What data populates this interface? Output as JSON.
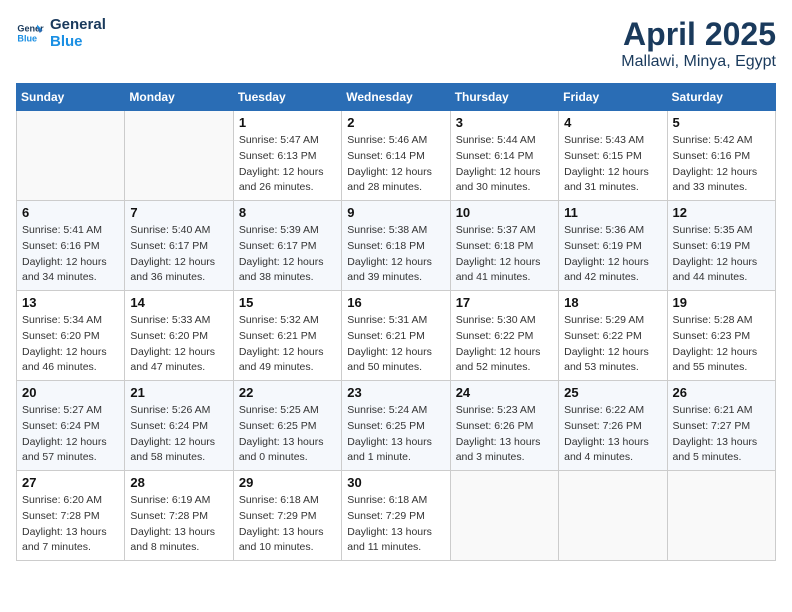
{
  "logo": {
    "line1": "General",
    "line2": "Blue"
  },
  "title": "April 2025",
  "subtitle": "Mallawi, Minya, Egypt",
  "days_of_week": [
    "Sunday",
    "Monday",
    "Tuesday",
    "Wednesday",
    "Thursday",
    "Friday",
    "Saturday"
  ],
  "weeks": [
    [
      {
        "day": "",
        "info": ""
      },
      {
        "day": "",
        "info": ""
      },
      {
        "day": "1",
        "info": "Sunrise: 5:47 AM\nSunset: 6:13 PM\nDaylight: 12 hours and 26 minutes."
      },
      {
        "day": "2",
        "info": "Sunrise: 5:46 AM\nSunset: 6:14 PM\nDaylight: 12 hours and 28 minutes."
      },
      {
        "day": "3",
        "info": "Sunrise: 5:44 AM\nSunset: 6:14 PM\nDaylight: 12 hours and 30 minutes."
      },
      {
        "day": "4",
        "info": "Sunrise: 5:43 AM\nSunset: 6:15 PM\nDaylight: 12 hours and 31 minutes."
      },
      {
        "day": "5",
        "info": "Sunrise: 5:42 AM\nSunset: 6:16 PM\nDaylight: 12 hours and 33 minutes."
      }
    ],
    [
      {
        "day": "6",
        "info": "Sunrise: 5:41 AM\nSunset: 6:16 PM\nDaylight: 12 hours and 34 minutes."
      },
      {
        "day": "7",
        "info": "Sunrise: 5:40 AM\nSunset: 6:17 PM\nDaylight: 12 hours and 36 minutes."
      },
      {
        "day": "8",
        "info": "Sunrise: 5:39 AM\nSunset: 6:17 PM\nDaylight: 12 hours and 38 minutes."
      },
      {
        "day": "9",
        "info": "Sunrise: 5:38 AM\nSunset: 6:18 PM\nDaylight: 12 hours and 39 minutes."
      },
      {
        "day": "10",
        "info": "Sunrise: 5:37 AM\nSunset: 6:18 PM\nDaylight: 12 hours and 41 minutes."
      },
      {
        "day": "11",
        "info": "Sunrise: 5:36 AM\nSunset: 6:19 PM\nDaylight: 12 hours and 42 minutes."
      },
      {
        "day": "12",
        "info": "Sunrise: 5:35 AM\nSunset: 6:19 PM\nDaylight: 12 hours and 44 minutes."
      }
    ],
    [
      {
        "day": "13",
        "info": "Sunrise: 5:34 AM\nSunset: 6:20 PM\nDaylight: 12 hours and 46 minutes."
      },
      {
        "day": "14",
        "info": "Sunrise: 5:33 AM\nSunset: 6:20 PM\nDaylight: 12 hours and 47 minutes."
      },
      {
        "day": "15",
        "info": "Sunrise: 5:32 AM\nSunset: 6:21 PM\nDaylight: 12 hours and 49 minutes."
      },
      {
        "day": "16",
        "info": "Sunrise: 5:31 AM\nSunset: 6:21 PM\nDaylight: 12 hours and 50 minutes."
      },
      {
        "day": "17",
        "info": "Sunrise: 5:30 AM\nSunset: 6:22 PM\nDaylight: 12 hours and 52 minutes."
      },
      {
        "day": "18",
        "info": "Sunrise: 5:29 AM\nSunset: 6:22 PM\nDaylight: 12 hours and 53 minutes."
      },
      {
        "day": "19",
        "info": "Sunrise: 5:28 AM\nSunset: 6:23 PM\nDaylight: 12 hours and 55 minutes."
      }
    ],
    [
      {
        "day": "20",
        "info": "Sunrise: 5:27 AM\nSunset: 6:24 PM\nDaylight: 12 hours and 57 minutes."
      },
      {
        "day": "21",
        "info": "Sunrise: 5:26 AM\nSunset: 6:24 PM\nDaylight: 12 hours and 58 minutes."
      },
      {
        "day": "22",
        "info": "Sunrise: 5:25 AM\nSunset: 6:25 PM\nDaylight: 13 hours and 0 minutes."
      },
      {
        "day": "23",
        "info": "Sunrise: 5:24 AM\nSunset: 6:25 PM\nDaylight: 13 hours and 1 minute."
      },
      {
        "day": "24",
        "info": "Sunrise: 5:23 AM\nSunset: 6:26 PM\nDaylight: 13 hours and 3 minutes."
      },
      {
        "day": "25",
        "info": "Sunrise: 6:22 AM\nSunset: 7:26 PM\nDaylight: 13 hours and 4 minutes."
      },
      {
        "day": "26",
        "info": "Sunrise: 6:21 AM\nSunset: 7:27 PM\nDaylight: 13 hours and 5 minutes."
      }
    ],
    [
      {
        "day": "27",
        "info": "Sunrise: 6:20 AM\nSunset: 7:28 PM\nDaylight: 13 hours and 7 minutes."
      },
      {
        "day": "28",
        "info": "Sunrise: 6:19 AM\nSunset: 7:28 PM\nDaylight: 13 hours and 8 minutes."
      },
      {
        "day": "29",
        "info": "Sunrise: 6:18 AM\nSunset: 7:29 PM\nDaylight: 13 hours and 10 minutes."
      },
      {
        "day": "30",
        "info": "Sunrise: 6:18 AM\nSunset: 7:29 PM\nDaylight: 13 hours and 11 minutes."
      },
      {
        "day": "",
        "info": ""
      },
      {
        "day": "",
        "info": ""
      },
      {
        "day": "",
        "info": ""
      }
    ]
  ]
}
